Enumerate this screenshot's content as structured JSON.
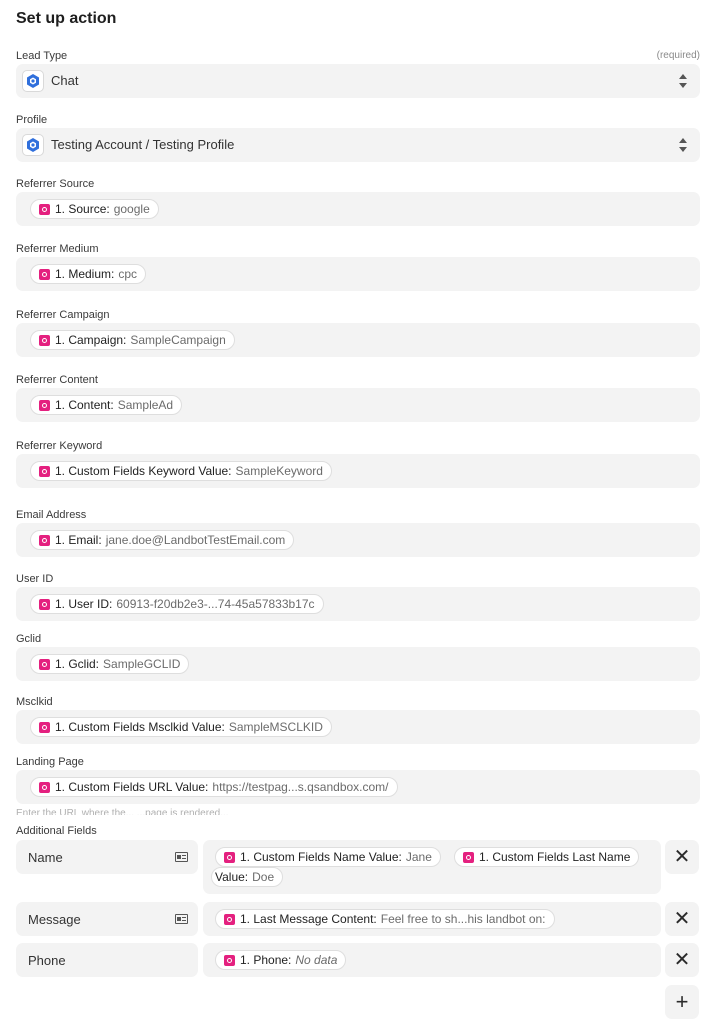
{
  "title": "Set up action",
  "required_label": "(required)",
  "lead_type": {
    "label": "Lead Type",
    "value": "Chat",
    "icon": "landbot-logo-icon"
  },
  "profile": {
    "label": "Profile",
    "value": "Testing Account / Testing Profile",
    "icon": "landbot-logo-icon"
  },
  "fields": [
    {
      "label": "Referrer Source",
      "pill_key": "1. Source:",
      "pill_value": "google"
    },
    {
      "label": "Referrer Medium",
      "pill_key": "1. Medium:",
      "pill_value": "cpc"
    },
    {
      "label": "Referrer Campaign",
      "pill_key": "1. Campaign:",
      "pill_value": "SampleCampaign"
    },
    {
      "label": "Referrer Content",
      "pill_key": "1. Content:",
      "pill_value": "SampleAd"
    },
    {
      "label": "Referrer Keyword",
      "pill_key": "1. Custom Fields Keyword Value:",
      "pill_value": "SampleKeyword"
    },
    {
      "label": "Email Address",
      "pill_key": "1. Email:",
      "pill_value": "jane.doe@LandbotTestEmail.com"
    },
    {
      "label": "User ID",
      "pill_key": "1. User ID:",
      "pill_value": "60913-f20db2e3-...74-45a57833b17c"
    },
    {
      "label": "Gclid",
      "pill_key": "1. Gclid:",
      "pill_value": "SampleGCLID"
    },
    {
      "label": "Msclkid",
      "pill_key": "1. Custom Fields Msclkid Value:",
      "pill_value": "SampleMSCLKID"
    },
    {
      "label": "Landing Page",
      "pill_key": "1. Custom Fields URL Value:",
      "pill_value": "https://testpag...s.qsandbox.com/"
    }
  ],
  "faded_hint": "Enter the URL where the... ...page is rendered...",
  "additional_fields": {
    "label": "Additional Fields",
    "rows": [
      {
        "key": "Name",
        "pills": [
          {
            "key": "1. Custom Fields Name Value:",
            "value": "Jane"
          },
          {
            "key": "1. Custom Fields Last Name",
            "value": ""
          },
          {
            "key": "Value:",
            "value": "Doe"
          }
        ]
      },
      {
        "key": "Message",
        "pills": [
          {
            "key": "1. Last Message Content:",
            "value": "Feel free to sh...his landbot on:"
          }
        ]
      },
      {
        "key": "Phone",
        "pills": [
          {
            "key": "1. Phone:",
            "value": "No data"
          }
        ]
      }
    ],
    "remove_symbol": "✕",
    "add_symbol": "+"
  }
}
